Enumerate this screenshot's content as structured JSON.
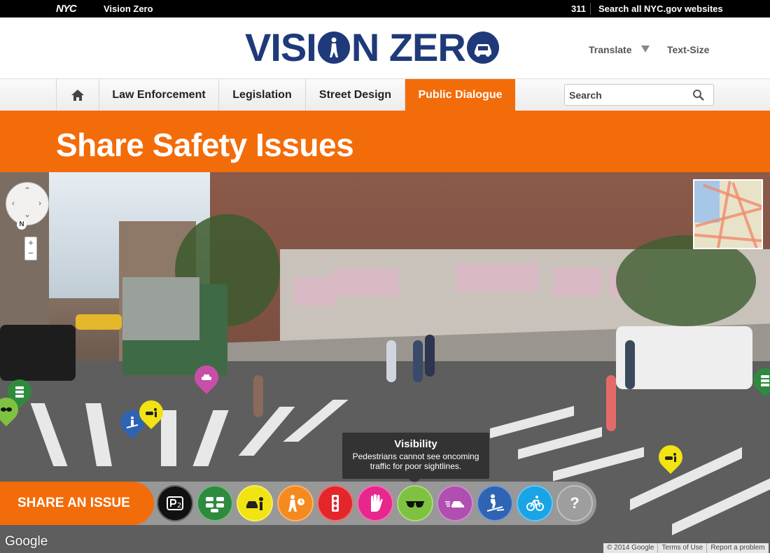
{
  "topbar": {
    "nyc_logo": "NYC",
    "site_name": "Vision Zero",
    "link_311": "311",
    "search_all": "Search all NYC.gov websites"
  },
  "header": {
    "logo_text_part1": "VISI",
    "logo_text_part2": "N ZER",
    "translate_label": "Translate",
    "textsize_label": "Text-Size"
  },
  "nav": {
    "home_icon": "home-icon",
    "tabs": [
      {
        "label": "Law Enforcement"
      },
      {
        "label": "Legislation"
      },
      {
        "label": "Street Design"
      },
      {
        "label": "Public Dialogue",
        "active": true
      }
    ],
    "search_placeholder": "Search"
  },
  "banner": {
    "title": "Share Safety Issues"
  },
  "map": {
    "google_logo": "Google",
    "footer": [
      "© 2014 Google",
      "Terms of Use",
      "Report a problem"
    ]
  },
  "tooltip": {
    "title": "Visibility",
    "body": "Pedestrians cannot see oncoming traffic for poor sightlines."
  },
  "share": {
    "button_label": "SHARE AN ISSUE",
    "categories": [
      {
        "icon": "double-parking-icon",
        "color": "#111111"
      },
      {
        "icon": "congestion-icon",
        "color": "#2e8b3e"
      },
      {
        "icon": "double-parked-car-icon",
        "color": "#f2e312"
      },
      {
        "icon": "pedestrian-walk-time-icon",
        "color": "#f58a1f"
      },
      {
        "icon": "traffic-signal-icon",
        "color": "#e3262a"
      },
      {
        "icon": "failure-to-yield-icon",
        "color": "#e8278c"
      },
      {
        "icon": "visibility-icon",
        "color": "#7fc241"
      },
      {
        "icon": "speeding-icon",
        "color": "#b04fb0"
      },
      {
        "icon": "jaywalking-icon",
        "color": "#2f64b4"
      },
      {
        "icon": "bike-icon",
        "color": "#1aa4e6"
      },
      {
        "icon": "other-question-icon",
        "color": "#9e9e9e",
        "label": "?"
      }
    ]
  },
  "colors": {
    "brand_orange": "#f36c0a",
    "brand_blue": "#1f3a7a"
  }
}
